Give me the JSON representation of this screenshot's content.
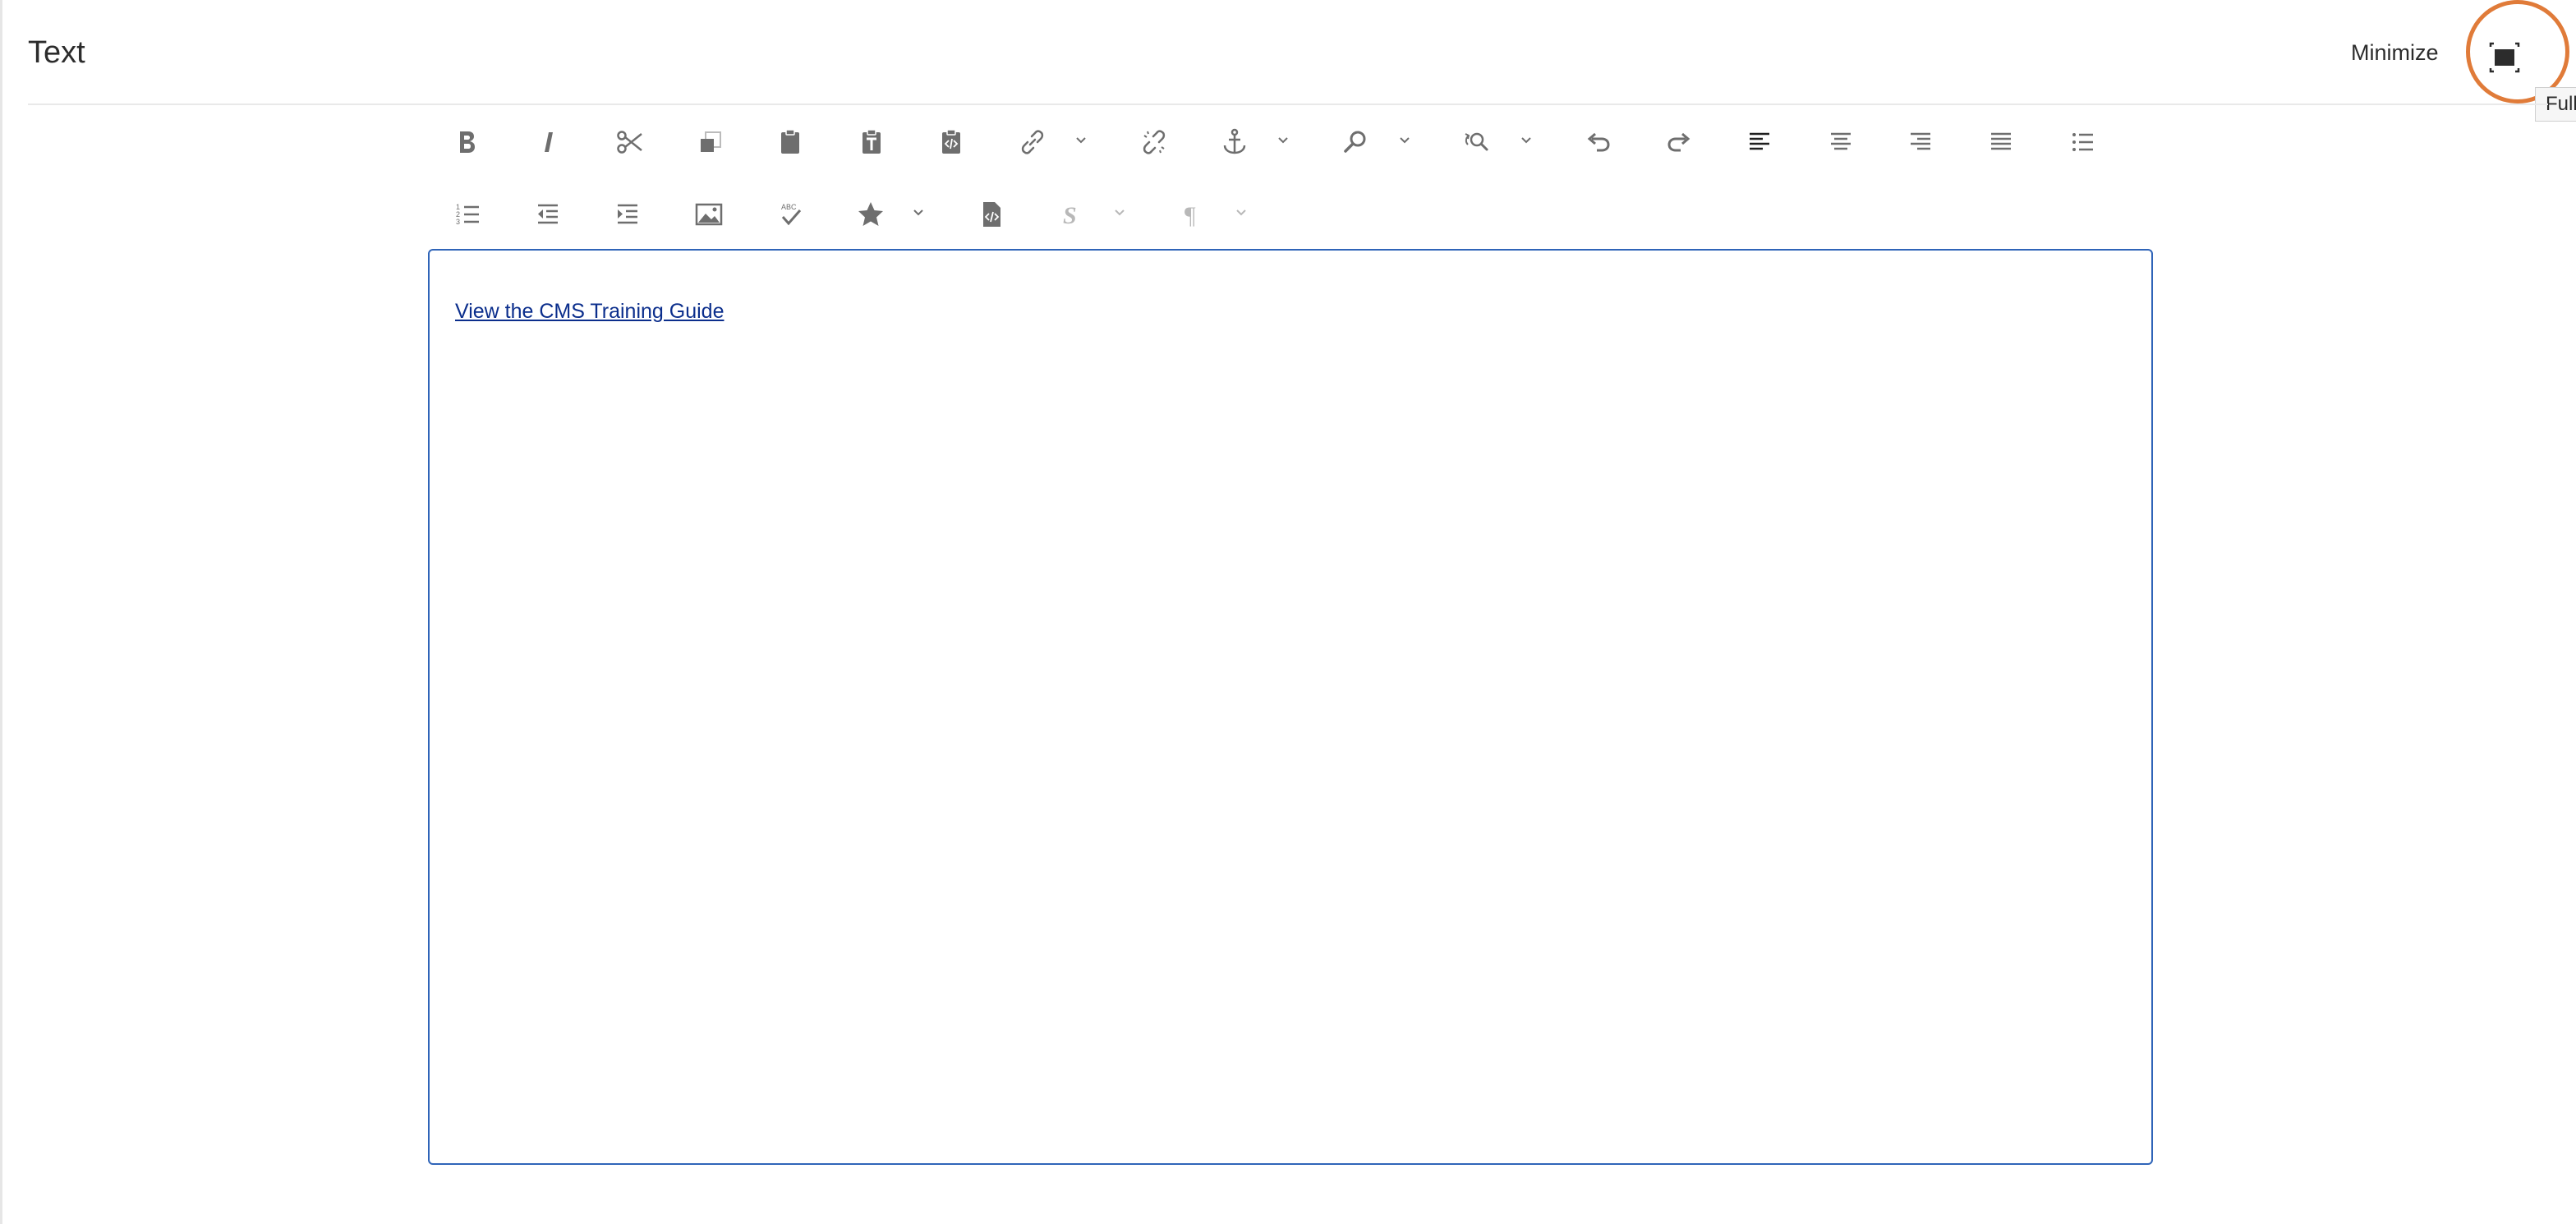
{
  "header": {
    "title": "Text",
    "minimize_label": "Minimize",
    "fullscreen_tooltip": "Full"
  },
  "toolbar": {
    "row1": [
      {
        "name": "bold-button",
        "icon": "bold-icon"
      },
      {
        "name": "italic-button",
        "icon": "italic-icon"
      },
      {
        "name": "cut-button",
        "icon": "scissors-icon"
      },
      {
        "name": "copy-button",
        "icon": "copy-icon"
      },
      {
        "name": "paste-button",
        "icon": "clipboard-icon"
      },
      {
        "name": "paste-as-text-button",
        "icon": "clipboard-text-icon"
      },
      {
        "name": "paste-from-word-button",
        "icon": "clipboard-code-icon"
      },
      {
        "name": "link-button",
        "icon": "link-icon",
        "dropdown": true
      },
      {
        "name": "unlink-button",
        "icon": "unlink-icon"
      },
      {
        "name": "anchor-button",
        "icon": "anchor-icon",
        "dropdown": true
      },
      {
        "name": "find-button",
        "icon": "search-icon",
        "dropdown": true
      },
      {
        "name": "find-replace-button",
        "icon": "find-replace-icon",
        "dropdown": true
      },
      {
        "name": "undo-button",
        "icon": "undo-icon"
      },
      {
        "name": "redo-button",
        "icon": "redo-icon"
      },
      {
        "name": "align-left-button",
        "icon": "align-left-icon"
      },
      {
        "name": "align-center-button",
        "icon": "align-center-icon"
      },
      {
        "name": "align-right-button",
        "icon": "align-right-icon"
      },
      {
        "name": "align-justify-button",
        "icon": "align-justify-icon"
      },
      {
        "name": "bulleted-list-button",
        "icon": "bulleted-list-icon"
      }
    ],
    "row2": [
      {
        "name": "numbered-list-button",
        "icon": "numbered-list-icon"
      },
      {
        "name": "outdent-button",
        "icon": "outdent-icon"
      },
      {
        "name": "indent-button",
        "icon": "indent-icon"
      },
      {
        "name": "image-button",
        "icon": "image-icon"
      },
      {
        "name": "spellcheck-button",
        "icon": "spellcheck-icon"
      },
      {
        "name": "special-characters-button",
        "icon": "star-icon",
        "dropdown": true
      },
      {
        "name": "source-edit-button",
        "icon": "file-code-icon"
      },
      {
        "name": "styles-button",
        "icon": "styles-icon",
        "dropdown": true,
        "disabled": true
      },
      {
        "name": "paragraph-format-button",
        "icon": "pilcrow-icon",
        "dropdown": true,
        "disabled": true
      }
    ]
  },
  "editor": {
    "link_text": "View the CMS Training Guide"
  },
  "colors": {
    "highlight_ring": "#e07b39",
    "editor_border": "#2f64b8",
    "link": "#0b2e8c",
    "icon": "#6e6e6e"
  }
}
